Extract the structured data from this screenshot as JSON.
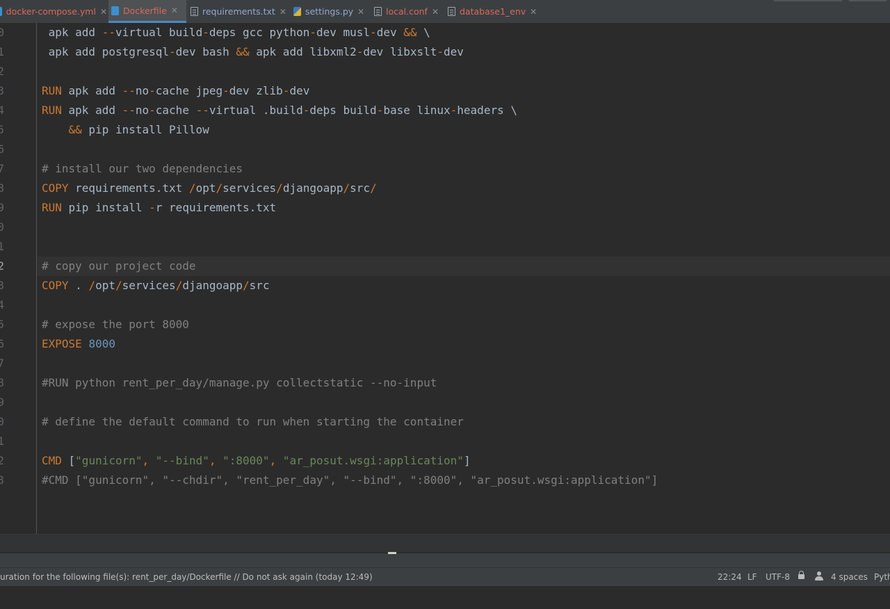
{
  "tabs": [
    {
      "label": "docker-compose.yml",
      "style": "red",
      "icon": "docker-icon"
    },
    {
      "label": "Dockerfile",
      "style": "red",
      "icon": "docker-icon",
      "active": true
    },
    {
      "label": "requirements.txt",
      "style": "blue",
      "icon": "text-file-icon"
    },
    {
      "label": "settings.py",
      "style": "blue",
      "icon": "python-file-icon"
    },
    {
      "label": "local.conf",
      "style": "red",
      "icon": "text-file-icon"
    },
    {
      "label": "database1_env",
      "style": "red",
      "icon": "text-file-icon"
    }
  ],
  "close_glyph": "✕",
  "editor": {
    "line_numbers": [
      "0",
      "1",
      "2",
      "3",
      "4",
      "5",
      "6",
      "7",
      "8",
      "9",
      "0",
      "1",
      "2",
      "3",
      "4",
      "5",
      "6",
      "7",
      "8",
      "9",
      "0",
      "1",
      "2",
      "3"
    ],
    "current_line_index": 12,
    "lines": [
      [
        {
          "t": "df",
          "v": " apk add "
        },
        {
          "t": "kw",
          "v": "--"
        },
        {
          "t": "df",
          "v": "virtual build"
        },
        {
          "t": "kw",
          "v": "-"
        },
        {
          "t": "df",
          "v": "deps gcc python"
        },
        {
          "t": "kw",
          "v": "-"
        },
        {
          "t": "df",
          "v": "dev musl"
        },
        {
          "t": "kw",
          "v": "-"
        },
        {
          "t": "df",
          "v": "dev "
        },
        {
          "t": "kw",
          "v": "&&"
        },
        {
          "t": "df",
          "v": " \\"
        }
      ],
      [
        {
          "t": "df",
          "v": " apk add postgresql"
        },
        {
          "t": "kw",
          "v": "-"
        },
        {
          "t": "df",
          "v": "dev bash "
        },
        {
          "t": "kw",
          "v": "&&"
        },
        {
          "t": "df",
          "v": " apk add libxml2"
        },
        {
          "t": "kw",
          "v": "-"
        },
        {
          "t": "df",
          "v": "dev libxslt"
        },
        {
          "t": "kw",
          "v": "-"
        },
        {
          "t": "df",
          "v": "dev"
        }
      ],
      [],
      [
        {
          "t": "kw",
          "v": "RUN"
        },
        {
          "t": "df",
          "v": " apk add "
        },
        {
          "t": "kw",
          "v": "--"
        },
        {
          "t": "df",
          "v": "no"
        },
        {
          "t": "kw",
          "v": "-"
        },
        {
          "t": "df",
          "v": "cache jpeg"
        },
        {
          "t": "kw",
          "v": "-"
        },
        {
          "t": "df",
          "v": "dev zlib"
        },
        {
          "t": "kw",
          "v": "-"
        },
        {
          "t": "df",
          "v": "dev"
        }
      ],
      [
        {
          "t": "kw",
          "v": "RUN"
        },
        {
          "t": "df",
          "v": " apk add "
        },
        {
          "t": "kw",
          "v": "--"
        },
        {
          "t": "df",
          "v": "no"
        },
        {
          "t": "kw",
          "v": "-"
        },
        {
          "t": "df",
          "v": "cache "
        },
        {
          "t": "kw",
          "v": "--"
        },
        {
          "t": "df",
          "v": "virtual .build"
        },
        {
          "t": "kw",
          "v": "-"
        },
        {
          "t": "df",
          "v": "deps build"
        },
        {
          "t": "kw",
          "v": "-"
        },
        {
          "t": "df",
          "v": "base linux"
        },
        {
          "t": "kw",
          "v": "-"
        },
        {
          "t": "df",
          "v": "headers \\"
        }
      ],
      [
        {
          "t": "df",
          "v": "    "
        },
        {
          "t": "kw",
          "v": "&&"
        },
        {
          "t": "df",
          "v": " pip install Pillow"
        }
      ],
      [],
      [
        {
          "t": "cm",
          "v": "# install our two dependencies"
        }
      ],
      [
        {
          "t": "kw",
          "v": "COPY"
        },
        {
          "t": "df",
          "v": " requirements.txt "
        },
        {
          "t": "kw",
          "v": "/"
        },
        {
          "t": "df",
          "v": "opt"
        },
        {
          "t": "kw",
          "v": "/"
        },
        {
          "t": "df",
          "v": "services"
        },
        {
          "t": "kw",
          "v": "/"
        },
        {
          "t": "df",
          "v": "djangoapp"
        },
        {
          "t": "kw",
          "v": "/"
        },
        {
          "t": "df",
          "v": "src"
        },
        {
          "t": "kw",
          "v": "/"
        }
      ],
      [
        {
          "t": "kw",
          "v": "RUN"
        },
        {
          "t": "df",
          "v": " pip install "
        },
        {
          "t": "kw",
          "v": "-"
        },
        {
          "t": "df",
          "v": "r requirements.txt"
        }
      ],
      [],
      [],
      [
        {
          "t": "cm",
          "v": "# copy our project code"
        }
      ],
      [
        {
          "t": "kw",
          "v": "COPY"
        },
        {
          "t": "df",
          "v": " . "
        },
        {
          "t": "kw",
          "v": "/"
        },
        {
          "t": "df",
          "v": "opt"
        },
        {
          "t": "kw",
          "v": "/"
        },
        {
          "t": "df",
          "v": "services"
        },
        {
          "t": "kw",
          "v": "/"
        },
        {
          "t": "df",
          "v": "djangoapp"
        },
        {
          "t": "kw",
          "v": "/"
        },
        {
          "t": "df",
          "v": "src"
        }
      ],
      [],
      [
        {
          "t": "cm",
          "v": "# expose the port 8000"
        }
      ],
      [
        {
          "t": "kw",
          "v": "EXPOSE"
        },
        {
          "t": "df",
          "v": " "
        },
        {
          "t": "nm",
          "v": "8000"
        }
      ],
      [],
      [
        {
          "t": "cm",
          "v": "#RUN python rent_per_day/manage.py collectstatic --no-input"
        }
      ],
      [],
      [
        {
          "t": "cm",
          "v": "# define the default command to run when starting the container"
        }
      ],
      [],
      [
        {
          "t": "kw",
          "v": "CMD"
        },
        {
          "t": "df",
          "v": " ["
        },
        {
          "t": "st",
          "v": "\"gunicorn\""
        },
        {
          "t": "kw",
          "v": ","
        },
        {
          "t": "df",
          "v": " "
        },
        {
          "t": "st",
          "v": "\"--bind\""
        },
        {
          "t": "kw",
          "v": ","
        },
        {
          "t": "df",
          "v": " "
        },
        {
          "t": "st",
          "v": "\":8000\""
        },
        {
          "t": "kw",
          "v": ","
        },
        {
          "t": "df",
          "v": " "
        },
        {
          "t": "st",
          "v": "\"ar_posut.wsgi:application\""
        },
        {
          "t": "df",
          "v": "]"
        }
      ],
      [
        {
          "t": "cm",
          "v": "#CMD [\"gunicorn\", \"--chdir\", \"rent_per_day\", \"--bind\", \":8000\", \"ar_posut.wsgi:application\"]"
        }
      ]
    ]
  },
  "status": {
    "message": "uration for the following file(s): rent_per_day/Dockerfile // Do not ask again (today 12:49)",
    "position": "22:24",
    "line_ending": "LF",
    "encoding": "UTF-8",
    "indent": "4 spaces",
    "interpreter": "Pyth"
  },
  "colors": {
    "keyword": "#cc7832",
    "comment": "#808080",
    "string": "#6a8759",
    "number": "#6897bb",
    "default": "#a9b7c6",
    "active_tab_underline": "#4a88c7"
  }
}
